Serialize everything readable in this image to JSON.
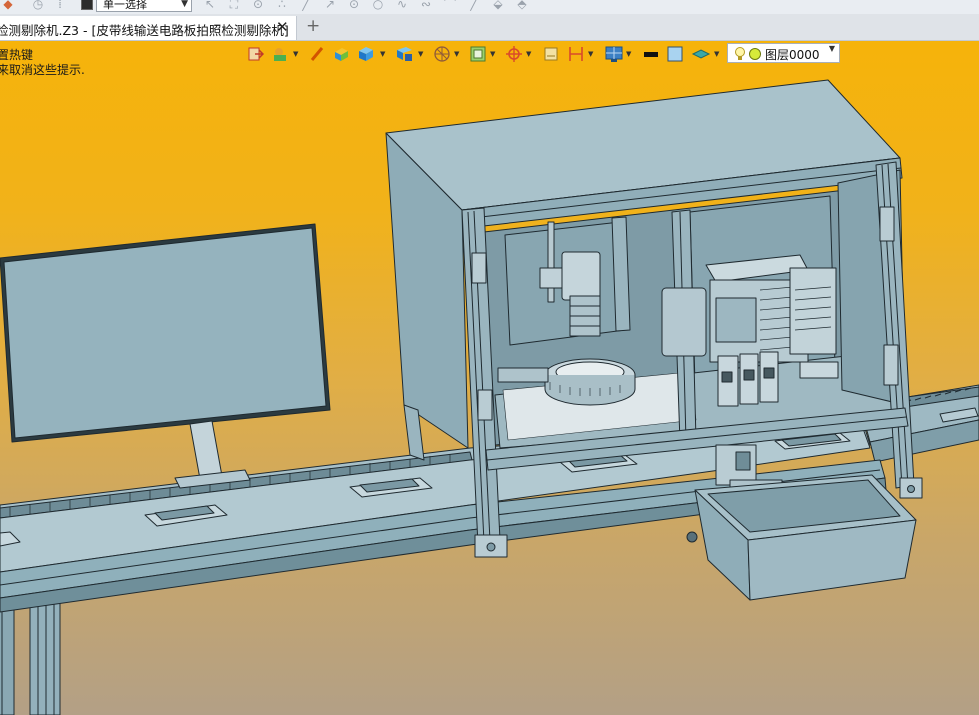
{
  "toolbar": {
    "selection_mode": "单一选择"
  },
  "tabs": {
    "active_title": "检测剔除机.Z3 - [皮带线输送电路板拍照检测剔除机]",
    "close_glyph": "✕",
    "new_tab_glyph": "+"
  },
  "hints": {
    "line1": "置热键",
    "line2": "来取消这些提示."
  },
  "layer": {
    "name": "图层0000"
  },
  "colors": {
    "viewport_top": "#f6b30a",
    "viewport_bottom": "#b3a086",
    "model_fill": "#94b2bd",
    "model_edge": "#1f2a30"
  },
  "icons": [
    "lightbulb-icon",
    "layer-color-icon",
    "box-solid-icon",
    "shading-icon",
    "measure-icon",
    "grid-icon"
  ]
}
